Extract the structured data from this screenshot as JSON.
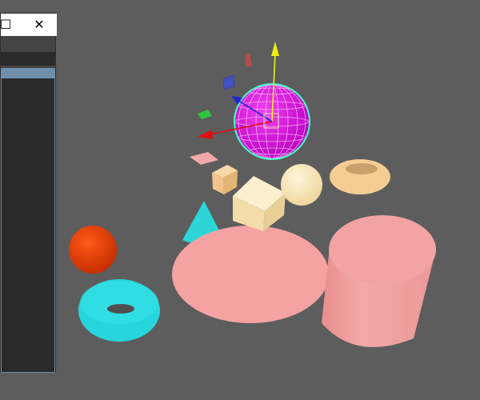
{
  "window": {
    "maximize_glyph": "☐",
    "close_glyph": "✕"
  },
  "panel": {
    "field_value": "",
    "selected_row": ""
  },
  "scene": {
    "objects": [
      {
        "name": "orange-sphere",
        "color": "#e63d00"
      },
      {
        "name": "cyan-torus",
        "color": "#27d7dd"
      },
      {
        "name": "cyan-cone",
        "color": "#2bd5d8"
      },
      {
        "name": "pink-disc",
        "color": "#f3a1a1"
      },
      {
        "name": "pink-cylinder",
        "color": "#f1a2a2"
      },
      {
        "name": "cream-cube-large",
        "color": "#f5e0ad"
      },
      {
        "name": "cream-cube-small",
        "color": "#f2c98f"
      },
      {
        "name": "cream-sphere",
        "color": "#f6e3b7"
      },
      {
        "name": "cream-torus",
        "color": "#f4cd93"
      },
      {
        "name": "selected-magenta-sphere",
        "color": "#e415e6",
        "wire_color": "#3dffc3"
      }
    ],
    "gizmo": {
      "x_axis_color": "#e01010",
      "y_axis_color": "#f1ee15",
      "z_axis_color": "#1e25d6"
    }
  }
}
